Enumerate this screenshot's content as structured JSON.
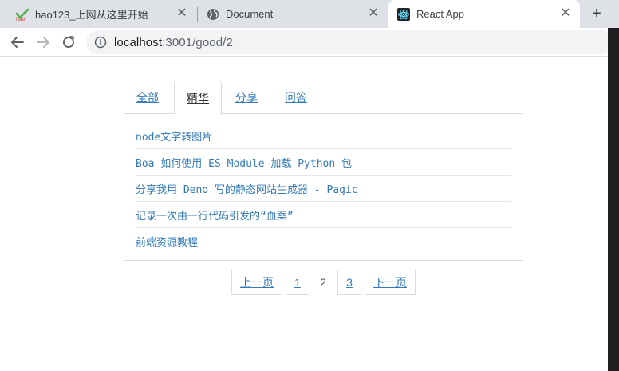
{
  "browser": {
    "tabs": [
      {
        "title": "hao123_上网从这里开始",
        "favicon": "hao123-icon",
        "active": false
      },
      {
        "title": "Document",
        "favicon": "globe-icon",
        "active": false
      },
      {
        "title": "React App",
        "favicon": "react-icon",
        "active": true
      }
    ],
    "close_glyph": "✕",
    "new_tab_glyph": "+",
    "url_host": "localhost",
    "url_path": ":3001/good/2"
  },
  "page": {
    "tabs": [
      {
        "label": "全部",
        "active": false
      },
      {
        "label": "精华",
        "active": true
      },
      {
        "label": "分享",
        "active": false
      },
      {
        "label": "问答",
        "active": false
      }
    ],
    "topics": [
      "node文字转图片",
      "Boa 如何使用 ES Module 加载 Python 包",
      "分享我用 Deno 写的静态网站生成器 - Pagic",
      "记录一次由一行代码引发的“血案”",
      "前端资源教程"
    ],
    "pagination": {
      "prev": "上一页",
      "pages": [
        "1",
        "2",
        "3"
      ],
      "current": "2",
      "next": "下一页"
    }
  },
  "colors": {
    "link": "#337ab7",
    "tab_strip": "#dee1e6",
    "omnibox": "#f1f3f4",
    "border": "#dddddd"
  }
}
